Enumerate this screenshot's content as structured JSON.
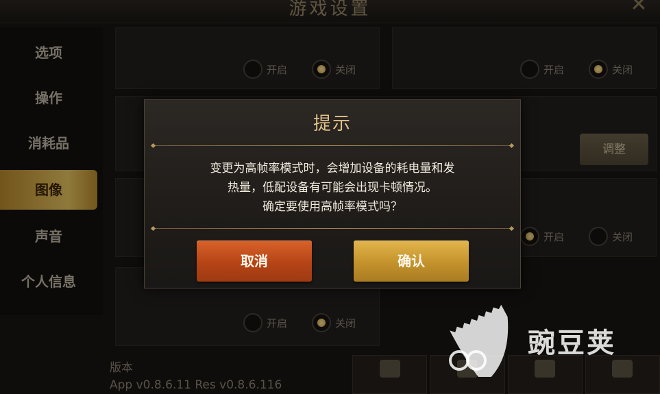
{
  "window": {
    "title": "游戏设置"
  },
  "sidebar": {
    "items": [
      {
        "label": "选项"
      },
      {
        "label": "操作"
      },
      {
        "label": "消耗品"
      },
      {
        "label": "图像",
        "active": true
      },
      {
        "label": "声音"
      },
      {
        "label": "个人信息"
      }
    ]
  },
  "settings": {
    "on_label": "开启",
    "off_label": "关闭",
    "adjust_label": "调整"
  },
  "footer": {
    "version_label": "版本",
    "version_value": "App v0.8.6.11 Res v0.8.6.116"
  },
  "dialog": {
    "title": "提示",
    "message_lines": [
      "变更为高帧率模式时，会增加设备的耗电量和发",
      "热量，低配设备有可能会出现卡顿情况。",
      "确定要使用高帧率模式吗？"
    ],
    "cancel_label": "取消",
    "confirm_label": "确认"
  },
  "watermark": {
    "text": "豌豆荚"
  },
  "colors": {
    "accent_gold": "#e3c38b",
    "cancel_button": "#c14b1b",
    "confirm_button": "#d6a53c"
  }
}
